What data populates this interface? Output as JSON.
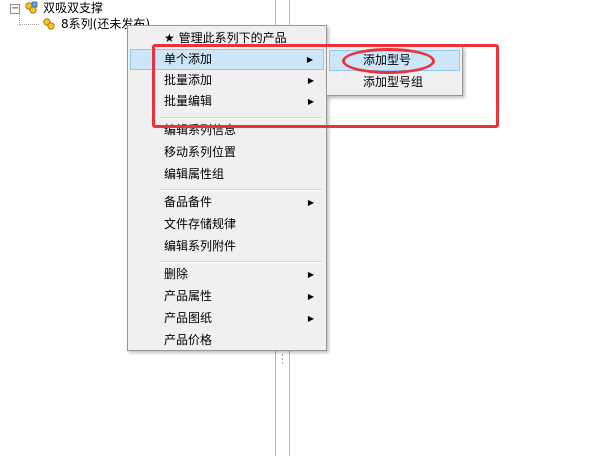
{
  "tree": {
    "root_label": "双吸双支撑",
    "expander": "−",
    "child_label": "8系列(还未发布)"
  },
  "menu": {
    "items": [
      {
        "label": "★ 管理此系列下的产品",
        "arrow": ""
      },
      {
        "label": "单个添加",
        "arrow": "▶"
      },
      {
        "label": "批量添加",
        "arrow": "▶"
      },
      {
        "label": "批量编辑",
        "arrow": "▶"
      },
      {
        "label": "编辑系列信息",
        "arrow": ""
      },
      {
        "label": "移动系列位置",
        "arrow": ""
      },
      {
        "label": "编辑属性组",
        "arrow": ""
      },
      {
        "label": "备品备件",
        "arrow": "▶"
      },
      {
        "label": "文件存储规律",
        "arrow": ""
      },
      {
        "label": "编辑系列附件",
        "arrow": ""
      },
      {
        "label": "删除",
        "arrow": "▶"
      },
      {
        "label": "产品属性",
        "arrow": "▶"
      },
      {
        "label": "产品图纸",
        "arrow": "▶"
      },
      {
        "label": "产品价格",
        "arrow": ""
      }
    ]
  },
  "submenu": {
    "items": [
      {
        "label": "添加型号"
      },
      {
        "label": "添加型号组"
      }
    ]
  },
  "colors": {
    "annotation": "#e8333a",
    "highlight": "#cde6f7",
    "highlight_border": "#90c8f6",
    "menu_bg": "#f0f0f0"
  }
}
